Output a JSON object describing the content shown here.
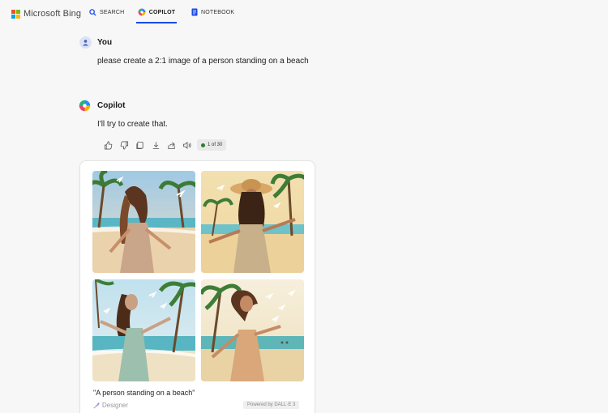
{
  "brand": {
    "logo_text": "Microsoft Bing",
    "logo_colors": [
      "#f25022",
      "#7fba00",
      "#00a4ef",
      "#ffb900"
    ]
  },
  "nav": {
    "search": "SEARCH",
    "copilot": "COPILOT",
    "notebook": "NOTEBOOK",
    "active": "copilot",
    "accent": "#174ae4"
  },
  "conversation": {
    "user": {
      "name": "You",
      "message": "please create a 2:1 image of a person standing on a beach"
    },
    "copilot": {
      "name": "Copilot",
      "message": "I'll try to create that."
    }
  },
  "actions": {
    "icons": [
      "thumbs-up-icon",
      "thumbs-down-icon",
      "copy-icon",
      "download-icon",
      "share-icon",
      "speaker-icon"
    ],
    "counter": "1 of 30",
    "counter_dot_color": "#2e7d32"
  },
  "result": {
    "images": [
      "beach-image-1",
      "beach-image-2",
      "beach-image-3",
      "beach-image-4"
    ],
    "caption": "\"A person standing on a beach\"",
    "designer": "Designer",
    "powered_by": "Powered by DALL·E 3"
  }
}
